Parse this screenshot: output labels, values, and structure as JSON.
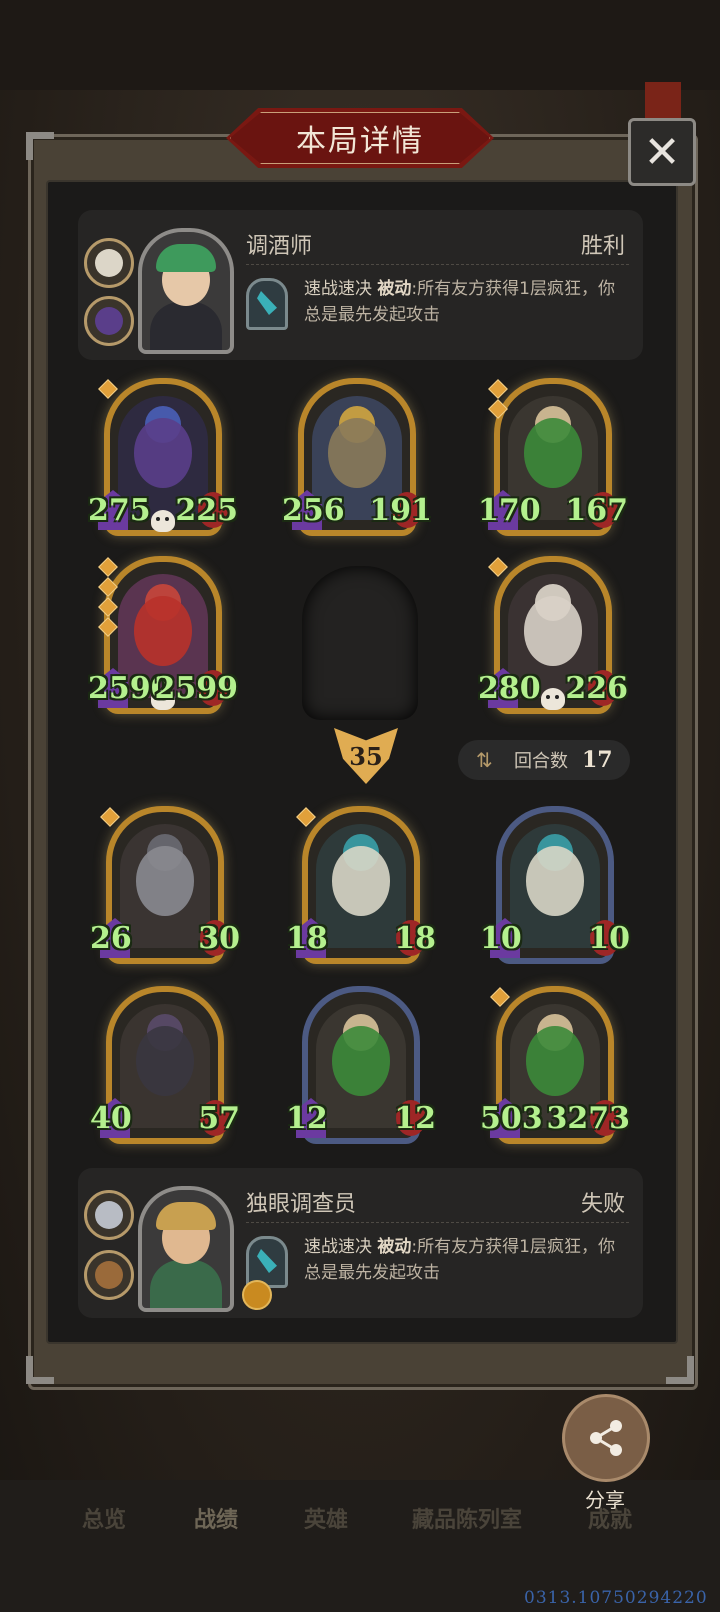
{
  "title": "本局详情",
  "close_label": "✕",
  "top_player": {
    "name": "调酒师",
    "result": "胜利",
    "skill_name": "速战速决",
    "skill_type": "被动",
    "skill_desc": ":所有友方获得1层疯狂，你总是最先发起攻击",
    "relic_icons": [
      "potion-icon",
      "crystal-icon"
    ]
  },
  "enemy_board": {
    "row1": [
      {
        "name": "blue-haired-sorceress",
        "atk": "275",
        "hp": "225",
        "gems": 1,
        "skull": true,
        "color": "#4a5fb8"
      },
      {
        "name": "bearded-king",
        "atk": "256",
        "hp": "191",
        "gems": 0,
        "skull": false,
        "color": "#8a7a5a"
      },
      {
        "name": "green-crocodile",
        "atk": "170",
        "hp": "167",
        "gems": 2,
        "skull": false,
        "color": "#3c8a3a"
      }
    ],
    "row2": [
      {
        "name": "red-dragon",
        "atk": "2590",
        "hp": "2599",
        "gems": 4,
        "skull": true,
        "color": "#b8322a"
      },
      {
        "name": "masked-rabbit",
        "atk": "280",
        "hp": "226",
        "gems": 1,
        "skull": true,
        "color": "#d8d0c6"
      }
    ]
  },
  "turn_number": "35",
  "rounds": {
    "label": "回合数",
    "value": "17"
  },
  "player_board": {
    "row1": [
      {
        "name": "grey-dragon",
        "atk": "26",
        "hp": "30",
        "gems": 1,
        "silver": false,
        "color": "#8a8a90"
      },
      {
        "name": "white-eastern-dragon",
        "atk": "18",
        "hp": "18",
        "gems": 1,
        "silver": false,
        "color": "#d8d6c6"
      },
      {
        "name": "white-eastern-dragon-silver",
        "atk": "10",
        "hp": "10",
        "gems": 0,
        "silver": true,
        "color": "#d8d6c6"
      }
    ],
    "row2": [
      {
        "name": "black-dragon",
        "atk": "40",
        "hp": "57",
        "gems": 0,
        "silver": false,
        "color": "#3a3640"
      },
      {
        "name": "green-crocodile-silver",
        "atk": "12",
        "hp": "12",
        "gems": 0,
        "silver": true,
        "color": "#3c8a3a"
      },
      {
        "name": "green-crocodile-gold",
        "atk": "503",
        "hp": "3273",
        "gems": 1,
        "silver": false,
        "color": "#3c8a3a"
      }
    ]
  },
  "bottom_player": {
    "name": "独眼调查员",
    "result": "失败",
    "skill_name": "速战速决",
    "skill_type": "被动",
    "skill_desc": ":所有友方获得1层疯狂，你总是最先发起攻击",
    "relic_icons": [
      "silver-tile-icon",
      "book-icon"
    ]
  },
  "share_label": "分享",
  "tabs": [
    "总览",
    "战绩",
    "英雄",
    "藏品陈列室",
    "成就"
  ],
  "active_tab": "战绩",
  "footer_id": "0313.10750294220",
  "colors": {
    "gold": "#b9862a",
    "stat_green": "#b4f08e",
    "title_red": "#7a1812"
  }
}
